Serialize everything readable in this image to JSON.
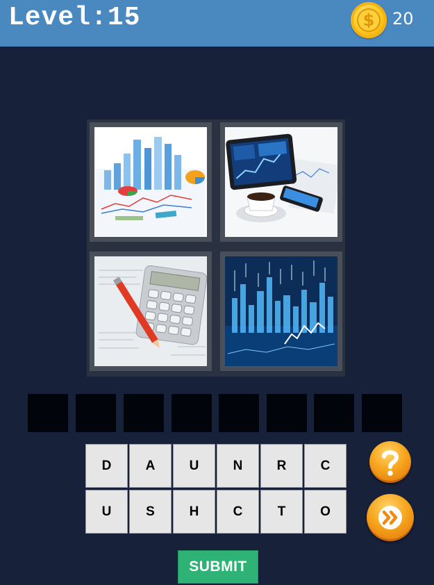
{
  "header": {
    "level_label": "Level:15",
    "coin_symbol": "$",
    "coins": "20"
  },
  "pictures": [
    {
      "icon": "bar-chart-buildings"
    },
    {
      "icon": "tablet-coffee-phone"
    },
    {
      "icon": "calculator-pencil"
    },
    {
      "icon": "blue-stock-chart"
    }
  ],
  "answer": {
    "slots": 8
  },
  "keyboard": {
    "rows": [
      [
        "D",
        "A",
        "U",
        "N",
        "R",
        "C"
      ],
      [
        "U",
        "S",
        "H",
        "C",
        "T",
        "O"
      ]
    ]
  },
  "buttons": {
    "help_icon": "question-mark",
    "skip_icon": "double-chevron",
    "submit_label": "SUBMIT"
  },
  "colors": {
    "background": "#18213a",
    "header": "#4a88c0",
    "submit": "#2eb276",
    "accent": "#f7a51d"
  }
}
